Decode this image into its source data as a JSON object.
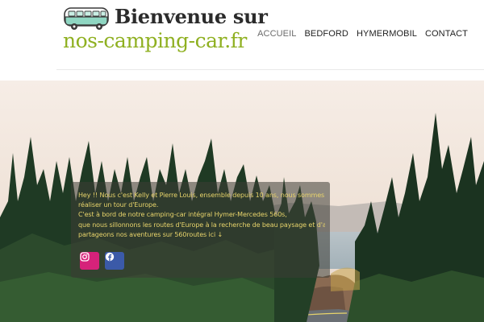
{
  "header": {
    "title_line1": "Bienvenue sur",
    "title_line2": "nos-camping-car.fr",
    "logo_icon": "camper-van-icon"
  },
  "nav": {
    "items": [
      {
        "label": "ACCUEIL",
        "active": true
      },
      {
        "label": "BEDFORD",
        "active": false
      },
      {
        "label": "HYMERMOBIL",
        "active": false
      },
      {
        "label": "CONTACT",
        "active": false
      }
    ]
  },
  "hero": {
    "intro_lines": [
      "Hey !! Nous c'est Kelly et Pierre Louis, ensemble depuis 10 ans, nous sommes en train de",
      "réaliser un tour d'Europe.",
      "C'est à bord de notre camping-car intégral Hymer-Mercedes 560s,",
      "que nous sillonnons les routes d'Europe à la recherche de beau paysage et d'aventure. Nous",
      "partageons nos aventures sur 560routes ici ↓"
    ],
    "social": [
      {
        "icon": "instagram-icon",
        "color": "#d6227a"
      },
      {
        "icon": "facebook-icon",
        "color": "#3b5aa8"
      }
    ]
  },
  "colors": {
    "accent": "#8fb021",
    "overlay_text": "#e8d46b"
  }
}
